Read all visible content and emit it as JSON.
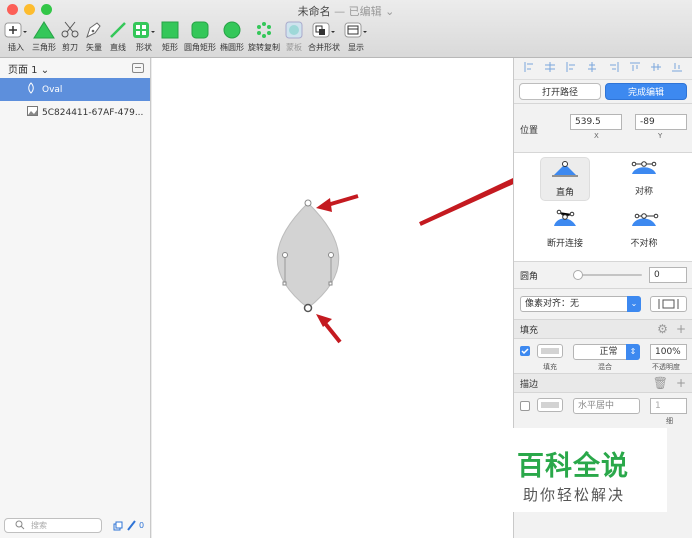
{
  "window": {
    "title": "未命名",
    "subtitle": "— 已编辑",
    "traffic_lights": [
      "#fc5f57",
      "#fdbc2e",
      "#33c748"
    ]
  },
  "toolbar": {
    "items": [
      {
        "label": "插入",
        "icon": "plus-icon"
      },
      {
        "label": "三角形",
        "icon": "triangle-icon"
      },
      {
        "label": "剪刀",
        "icon": "scissors-icon"
      },
      {
        "label": "矢量",
        "icon": "pen-icon"
      },
      {
        "label": "直线",
        "icon": "line-icon"
      },
      {
        "label": "形状",
        "icon": "shapes-icon"
      },
      {
        "label": "矩形",
        "icon": "rectangle-icon"
      },
      {
        "label": "圆角矩形",
        "icon": "rounded-rectangle-icon"
      },
      {
        "label": "椭圆形",
        "icon": "oval-icon"
      },
      {
        "label": "旋转复制",
        "icon": "rotate-copy-icon"
      },
      {
        "label": "蒙板",
        "icon": "mask-icon"
      },
      {
        "label": "合并形状",
        "icon": "combine-icon"
      },
      {
        "label": "显示",
        "icon": "view-icon"
      }
    ],
    "accent": "#34c759"
  },
  "sidebar": {
    "page_label": "页面 1 ⌄",
    "layers": [
      {
        "name": "Oval",
        "icon": "oval-outline-icon",
        "selected": true
      },
      {
        "name": "5C824411-67AF-479...",
        "icon": "image-icon",
        "selected": false
      }
    ],
    "search_placeholder": "搜索",
    "footer_count": "0"
  },
  "inspector": {
    "open_path": "打开路径",
    "finish_edit": "完成编辑",
    "position_label": "位置",
    "x_value": "539.5",
    "y_value": "-89",
    "x_caption": "X",
    "y_caption": "Y",
    "point_types": [
      {
        "label": "直角",
        "selected": true
      },
      {
        "label": "对称",
        "selected": false
      },
      {
        "label": "断开连接",
        "selected": false
      },
      {
        "label": "不对称",
        "selected": false
      }
    ],
    "corner_label": "圆角",
    "corner_value": "0",
    "pixel_align": "像素对齐：无",
    "fill": {
      "title": "填充",
      "blend": "正常",
      "opacity": "100%",
      "fill_caption": "填充",
      "blend_caption": "混合",
      "opacity_caption": "不透明度",
      "color": "#d3d3d3"
    },
    "border": {
      "title": "描边",
      "position": "水平居中",
      "width": "1",
      "width_caption": "细"
    }
  },
  "watermark": {
    "title": "百科全说",
    "subtitle": "助你轻松解决"
  },
  "annotation_color": "#c41a20"
}
